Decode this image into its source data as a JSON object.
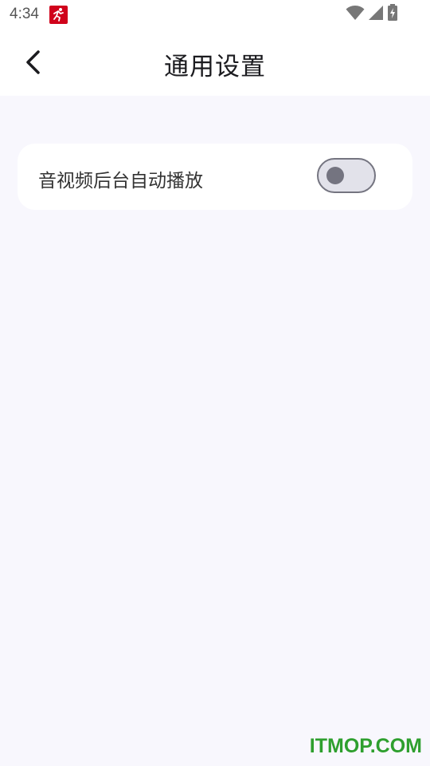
{
  "status_bar": {
    "time": "4:34",
    "icons": [
      "app-notification-icon",
      "wifi-icon",
      "signal-icon",
      "battery-charging-icon"
    ]
  },
  "header": {
    "back_icon": "chevron-left-icon",
    "title": "通用设置"
  },
  "settings": {
    "items": [
      {
        "label": "音视频后台自动播放",
        "enabled": false
      }
    ]
  },
  "watermark": {
    "text": "ITMOP.COM"
  },
  "colors": {
    "background": "#f8f7fd",
    "card": "#ffffff",
    "toggle_outline": "#747480",
    "toggle_track": "#e2e2ea",
    "watermark": "#2e9f2e",
    "notif_icon": "#d0021b"
  }
}
